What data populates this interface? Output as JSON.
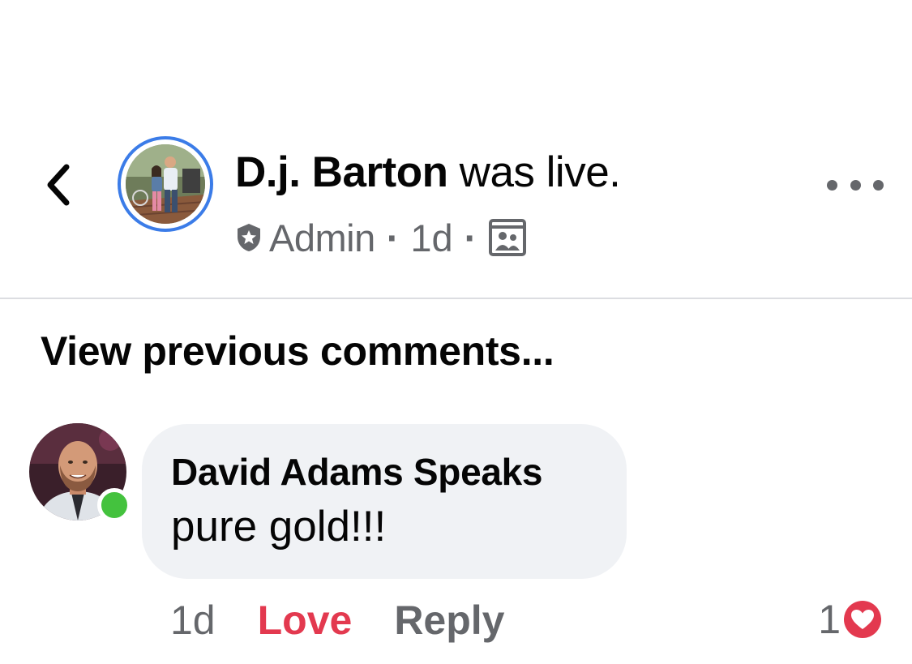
{
  "header": {
    "author_name": "D.j. Barton",
    "action_text": " was live.",
    "role": "Admin",
    "separator": "·",
    "time_ago": "1d",
    "audience_icon": "group-icon",
    "accent_color": "#3b7ce8"
  },
  "comments": {
    "view_previous_label": "View previous comments...",
    "items": [
      {
        "author": "David Adams Speaks",
        "text": "pure gold!!!",
        "time_ago": "1d",
        "love_label": "Love",
        "reply_label": "Reply",
        "reaction_count": "1",
        "reaction_type": "love",
        "online": true
      }
    ]
  },
  "colors": {
    "love": "#e3394f",
    "online": "#44c23e",
    "bubble": "#f0f2f5",
    "secondary_text": "#65676b"
  }
}
